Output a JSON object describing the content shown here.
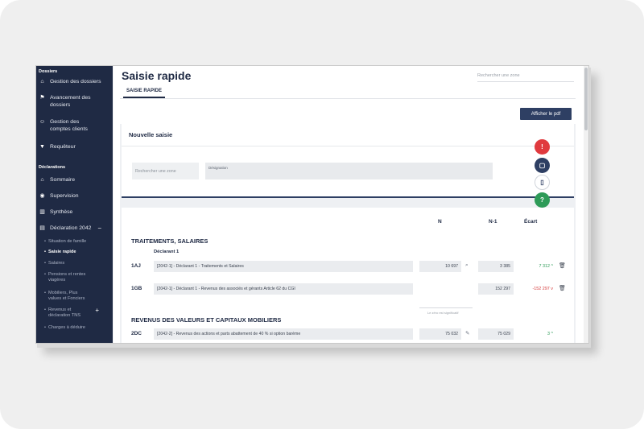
{
  "sidebar": {
    "section_dossiers": "Dossiers",
    "section_declarations": "Déclarations",
    "items": [
      {
        "label": "Gestion des dossiers"
      },
      {
        "label": "Avancement des dossiers"
      },
      {
        "label": "Gestion des comptes clients"
      },
      {
        "label": "Requêteur"
      },
      {
        "label": "Sommaire"
      },
      {
        "label": "Supervision"
      },
      {
        "label": "Synthèse"
      },
      {
        "label": "Déclaration 2042"
      }
    ],
    "declaration_collapse": "−",
    "subitems": [
      {
        "label": "Situation de famille"
      },
      {
        "label": "Saisie rapide"
      },
      {
        "label": "Salaires"
      },
      {
        "label": "Pensions et rentes viagères"
      },
      {
        "label": "Mobiliers, Plus values et Fonciers"
      },
      {
        "label": "Revenus et déclaration TNS"
      },
      {
        "label": "Charges à déduire"
      }
    ],
    "revenus_expand": "+"
  },
  "header": {
    "title": "Saisie rapide",
    "search_placeholder": "Rechercher une zone",
    "tab": "SAISIE RAPIDE",
    "pdf_button": "Afficher le pdf"
  },
  "new_entry": {
    "title": "Nouvelle saisie",
    "search_placeholder": "Rechercher une zone",
    "designation_label": "Désignation"
  },
  "table": {
    "col_n": "N",
    "col_n1": "N-1",
    "col_ecart": "Écart",
    "section1": "TRAITEMENTS, SALAIRES",
    "declarant": "Déclarant 1",
    "section2": "REVENUS DES VALEURS ET CAPITAUX MOBILIERS",
    "not_significant_note": "Le zéro est significatif",
    "rows": [
      {
        "code": "1AJ",
        "desc": "[2042-1] - Déclarant 1 - Traitements et Salaires",
        "n": "10 697",
        "n1": "3 385",
        "ecart": "7 312",
        "trend": "up"
      },
      {
        "code": "1GB",
        "desc": "[2042-1] - Déclarant 1 - Revenus des associés et gérants Article 62 du CGI",
        "n": "",
        "n1": "152 297",
        "ecart": "-152 297",
        "trend": "down"
      },
      {
        "code": "2DC",
        "desc": "[2042-2] - Revenus des actions et parts abattement de 40 % si option barème",
        "n": "75 032",
        "n1": "75 029",
        "ecart": "3",
        "trend": "up"
      }
    ]
  },
  "colors": {
    "sidebar_bg": "#1f2a44",
    "accent": "#2e3f63",
    "positive": "#2e9b58",
    "negative": "#d53a3a",
    "fab_alert": "#e03a3e",
    "fab_note": "#2e3f63",
    "fab_help": "#2e9b58"
  },
  "icons": [
    "home-icon",
    "flag-icon",
    "users-icon",
    "filter-icon",
    "home-icon",
    "eye-icon",
    "chart-icon",
    "document-icon",
    "search-icon",
    "edit-icon",
    "trash-icon",
    "chevron-up-icon",
    "chevron-down-icon",
    "alert-icon",
    "note-icon",
    "file-icon",
    "help-icon"
  ]
}
